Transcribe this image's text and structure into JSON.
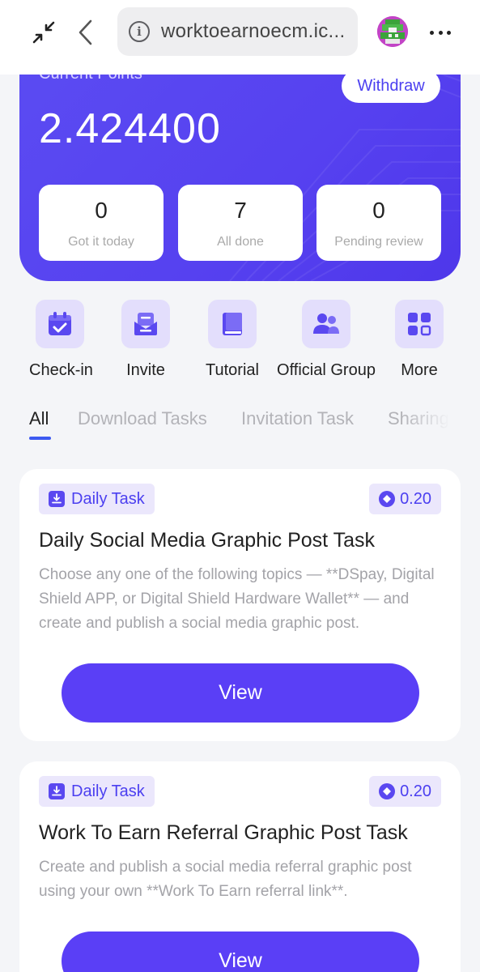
{
  "browser": {
    "url": "worktoearnoecm.ic...",
    "info_glyph": "i",
    "collapse_icon": "collapse-arrows-icon",
    "back_icon": "chevron-left-icon",
    "menu_icon": "three-dots-icon"
  },
  "points": {
    "label": "Current Points",
    "value": "2.424400",
    "withdraw_label": "Withdraw",
    "stats": [
      {
        "value": "0",
        "label": "Got it today"
      },
      {
        "value": "7",
        "label": "All done"
      },
      {
        "value": "0",
        "label": "Pending review"
      }
    ]
  },
  "shortcuts": [
    {
      "label": "Check-in",
      "icon": "calendar-check-icon"
    },
    {
      "label": "Invite",
      "icon": "envelope-icon"
    },
    {
      "label": "Tutorial",
      "icon": "book-icon"
    },
    {
      "label": "Official Group",
      "icon": "group-icon"
    },
    {
      "label": "More",
      "icon": "grid-icon"
    }
  ],
  "tabs": [
    {
      "label": "All",
      "active": true
    },
    {
      "label": "Download Tasks",
      "active": false
    },
    {
      "label": "Invitation Task",
      "active": false
    },
    {
      "label": "Sharing",
      "active": false
    }
  ],
  "tasks": [
    {
      "badge": "Daily Task",
      "reward": "0.20",
      "title": "Daily Social Media Graphic Post Task",
      "description": "Choose any one of the following topics — **DSpay, Digital Shield APP, or Digital Shield Hardware Wallet** — and create and publish a social media graphic post.",
      "button": "View"
    },
    {
      "badge": "Daily Task",
      "reward": "0.20",
      "title": "Work To Earn Referral Graphic Post Task",
      "description": "Create and publish a social media referral graphic post using your own **Work To Earn referral link**.",
      "button": "View"
    }
  ],
  "colors": {
    "primary": "#5a3ff6",
    "card_gradient_start": "#5b4cf2",
    "badge_bg": "#ebe7fc",
    "icon_bg": "#e3defc",
    "page_bg": "#f4f5f8"
  }
}
